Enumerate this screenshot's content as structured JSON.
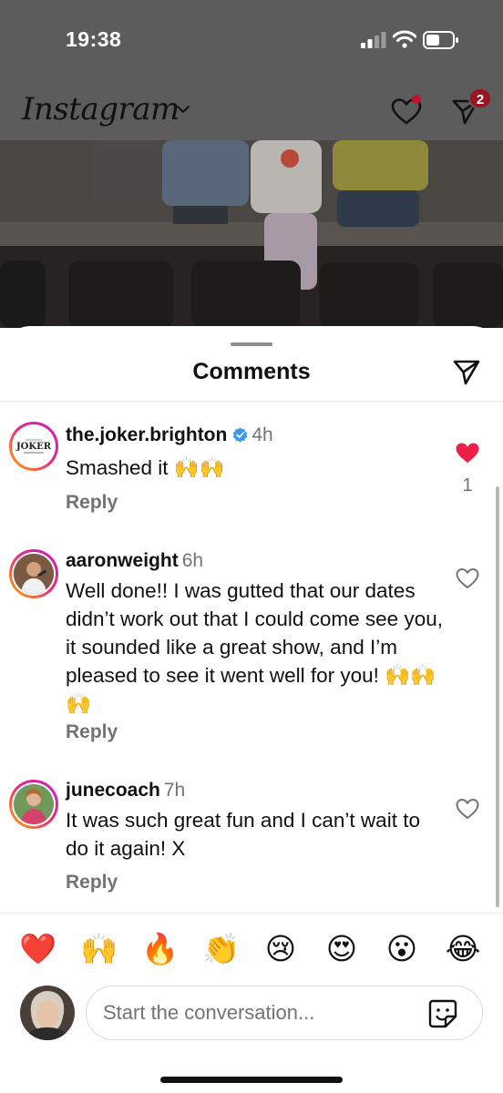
{
  "status_bar": {
    "time": "19:38"
  },
  "header": {
    "logo": "Instagram",
    "dm_badge": "2"
  },
  "sheet": {
    "title": "Comments"
  },
  "comments": [
    {
      "username": "the.joker.brighton",
      "verified": true,
      "time": "4h",
      "text": "Smashed it 🙌🙌",
      "reply": "Reply",
      "liked": true,
      "like_count": "1",
      "avatar_text": "JOKER"
    },
    {
      "username": "aaronweight",
      "time": "6h",
      "text": "Well done!! I was gutted that our dates didn’t work out that I could come see you, it sounded like a great show, and I’m pleased to see it went well for you! 🙌🙌🙌",
      "reply": "Reply",
      "liked": false
    },
    {
      "username": "junecoach",
      "time": "7h",
      "text": "It was such great fun and I can’t wait to do it again! X",
      "reply": "Reply",
      "liked": false
    }
  ],
  "quick_reactions": [
    "❤️",
    "🙌",
    "🔥",
    "👏",
    "😢",
    "😍",
    "😮",
    "😂"
  ],
  "composer": {
    "placeholder": "Start the conversation..."
  },
  "colors": {
    "like_red": "#ed1f46",
    "verified_blue": "#3897f0",
    "secondary_text": "#737373"
  }
}
